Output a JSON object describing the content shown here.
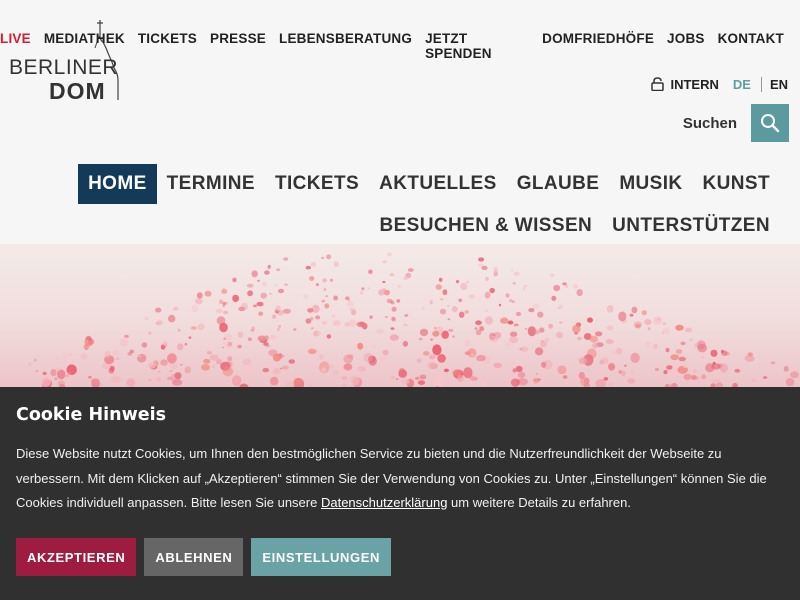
{
  "logo": {
    "line1": "BERLINER",
    "line2": "DOM"
  },
  "topnav": [
    {
      "label": "LIVE",
      "name": "topnav-live"
    },
    {
      "label": "MEDIATHEK",
      "name": "topnav-mediathek"
    },
    {
      "label": "TICKETS",
      "name": "topnav-tickets"
    },
    {
      "label": "PRESSE",
      "name": "topnav-presse"
    },
    {
      "label": "LEBENSBERATUNG",
      "name": "topnav-lebensberatung"
    },
    {
      "label": "JETZT SPENDEN",
      "name": "topnav-jetzt-spenden"
    },
    {
      "label": "DOMFRIEDHÖFE",
      "name": "topnav-domfriedhoefe"
    },
    {
      "label": "JOBS",
      "name": "topnav-jobs"
    },
    {
      "label": "KONTAKT",
      "name": "topnav-kontakt"
    }
  ],
  "utility": {
    "intern": "INTERN",
    "lang_de": "DE",
    "lang_en": "EN"
  },
  "search": {
    "label": "Suchen"
  },
  "mainnav": {
    "row1": [
      "HOME",
      "TERMINE",
      "TICKETS",
      "AKTUELLES",
      "GLAUBE",
      "MUSIK",
      "KUNST"
    ],
    "row2": [
      "BESUCHEN & WISSEN",
      "UNTERSTÜTZEN"
    ]
  },
  "cookie": {
    "title": "Cookie Hinweis",
    "text_before_link": "Diese Website nutzt Cookies, um Ihnen den bestmöglichen Service zu bieten und die Nutzerfreundlichkeit der Webseite zu verbessern. Mit dem Klicken auf „Akzeptieren“ stimmen Sie der Verwendung von Cookies zu. Unter „Einstellungen“ können Sie die Cookies individuell anpassen. Bitte lesen Sie unsere ",
    "link": "Datenschutzerklärung",
    "text_after_link": " um weitere Details zu erfahren.",
    "accept": "AKZEPTIEREN",
    "decline": "ABLEHNEN",
    "settings": "EINSTELLUNGEN"
  },
  "colors": {
    "live": "#d21f2f",
    "active_nav": "#143a5a",
    "search_button": "#5b9a9f",
    "accept_button": "#9e1c3f",
    "decline_button": "#666666",
    "settings_button": "#6aa3a6",
    "cookie_bg": "#303030"
  }
}
